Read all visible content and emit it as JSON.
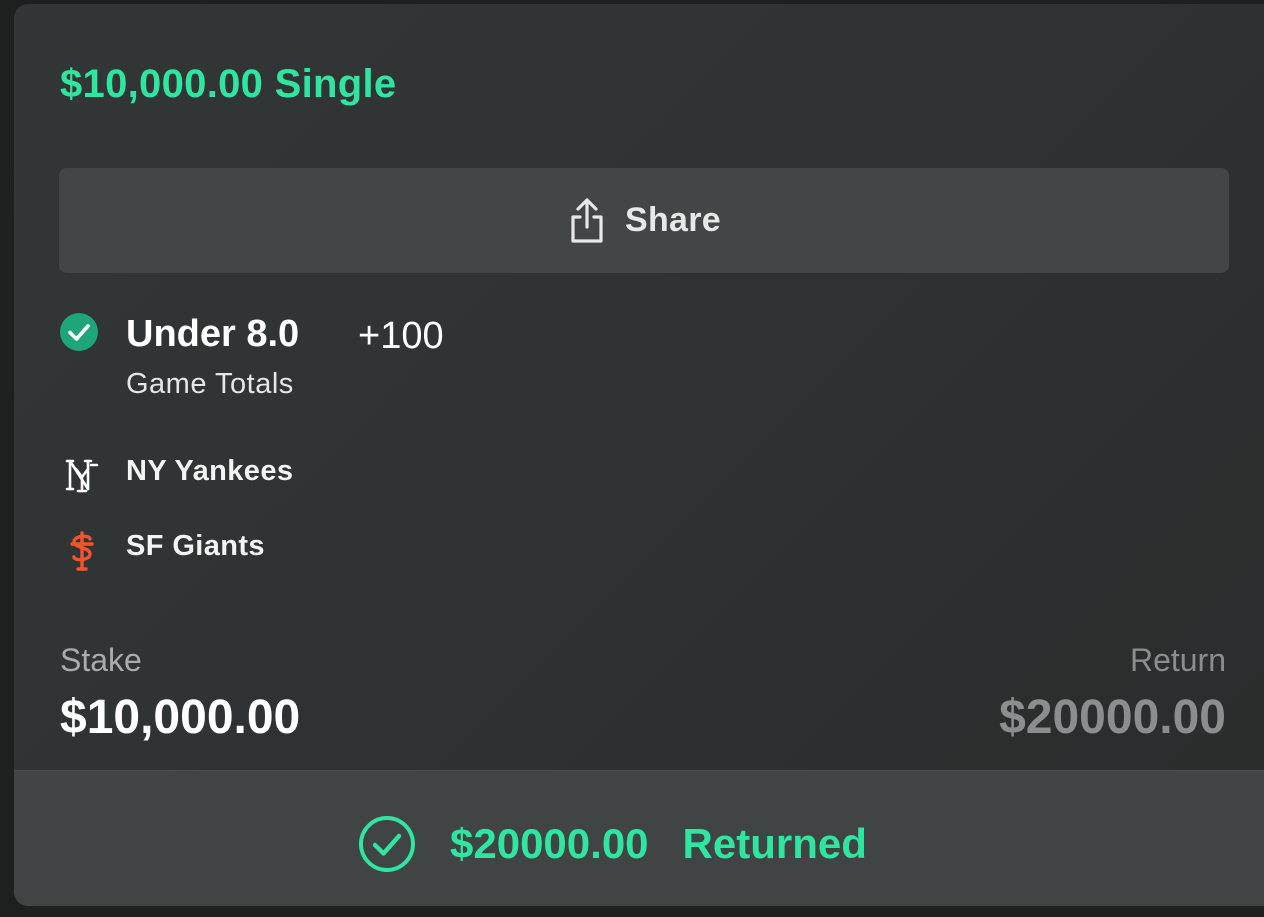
{
  "bet": {
    "title": "$10,000.00 Single",
    "share_label": "Share",
    "selection": "Under 8.0",
    "odds": "+100",
    "market": "Game Totals",
    "status_icon": "check-circle-icon"
  },
  "teams": [
    {
      "name": "NY Yankees",
      "logo": "ny-yankees-logo"
    },
    {
      "name": "SF Giants",
      "logo": "sf-giants-logo"
    }
  ],
  "summary": {
    "stake_label": "Stake",
    "stake_value": "$10,000.00",
    "return_label": "Return",
    "return_value": "$20000.00"
  },
  "footer": {
    "amount": "$20000.00",
    "status": "Returned"
  },
  "colors": {
    "accent": "#2ee6a0",
    "check_badge": "#1ea57a",
    "giants_orange": "#f2552c",
    "muted": "#8a8e8e"
  }
}
